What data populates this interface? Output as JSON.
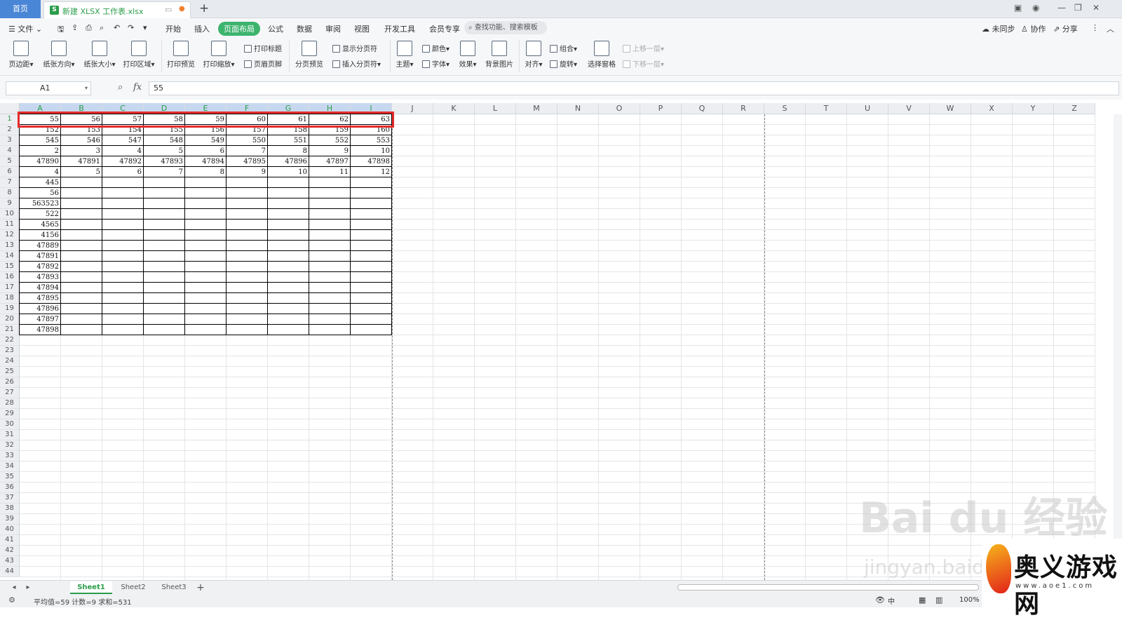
{
  "titlebar": {
    "home_tab": "首页",
    "doc_tab": "新建 XLSX 工作表.xlsx",
    "new_tab": "+"
  },
  "menu": {
    "items": [
      "文件",
      "开始",
      "插入",
      "页面布局",
      "公式",
      "数据",
      "审阅",
      "视图",
      "开发工具",
      "会员专享"
    ],
    "active": "页面布局",
    "search_placeholder": "查找功能、搜索模板",
    "right": [
      "未同步",
      "协作",
      "分享"
    ]
  },
  "ribbon": {
    "large": [
      "页边距",
      "纸张方向",
      "纸张大小",
      "打印区域",
      "打印预览",
      "打印缩放",
      "分页预览",
      "主题",
      "效果",
      "背景图片",
      "对齐",
      "选择窗格"
    ],
    "small": [
      "打印标题",
      "页眉页脚",
      "显示分页符",
      "插入分页符",
      "颜色",
      "字体",
      "组合",
      "旋转",
      "上移一层",
      "下移一层"
    ]
  },
  "formula": {
    "name_box": "A1",
    "fx": "fx",
    "value": "55"
  },
  "columns": [
    "A",
    "B",
    "C",
    "D",
    "E",
    "F",
    "G",
    "H",
    "I",
    "J",
    "K",
    "L",
    "M",
    "N",
    "O",
    "P",
    "Q",
    "R",
    "S",
    "T",
    "U",
    "V",
    "W",
    "X",
    "Y",
    "Z"
  ],
  "rows": [
    "1",
    "2",
    "3",
    "4",
    "5",
    "6",
    "7",
    "8",
    "9",
    "10",
    "11",
    "12",
    "13",
    "14",
    "15",
    "16",
    "17",
    "18",
    "19",
    "20",
    "21",
    "22",
    "23",
    "24",
    "25",
    "26",
    "27",
    "28",
    "29",
    "30",
    "31",
    "32",
    "33",
    "34",
    "35",
    "36",
    "37",
    "38",
    "39",
    "40",
    "41",
    "42",
    "43",
    "44"
  ],
  "cells": [
    [
      "55",
      "56",
      "57",
      "58",
      "59",
      "60",
      "61",
      "62",
      "63"
    ],
    [
      "152",
      "153",
      "154",
      "155",
      "156",
      "157",
      "158",
      "159",
      "160"
    ],
    [
      "545",
      "546",
      "547",
      "548",
      "549",
      "550",
      "551",
      "552",
      "553"
    ],
    [
      "2",
      "3",
      "4",
      "5",
      "6",
      "7",
      "8",
      "9",
      "10"
    ],
    [
      "47890",
      "47891",
      "47892",
      "47893",
      "47894",
      "47895",
      "47896",
      "47897",
      "47898"
    ],
    [
      "4",
      "5",
      "6",
      "7",
      "8",
      "9",
      "10",
      "11",
      "12"
    ],
    [
      "445"
    ],
    [
      "56"
    ],
    [
      "563523"
    ],
    [
      "522"
    ],
    [
      "4565"
    ],
    [
      "4156"
    ],
    [
      "47889"
    ],
    [
      "47891"
    ],
    [
      "47892"
    ],
    [
      "47893"
    ],
    [
      "47894"
    ],
    [
      "47895"
    ],
    [
      "47896"
    ],
    [
      "47897"
    ],
    [
      "47898"
    ]
  ],
  "sheets": {
    "tabs": [
      "Sheet1",
      "Sheet2",
      "Sheet3"
    ],
    "active": "Sheet1",
    "add": "+"
  },
  "status": {
    "text": "平均值=59  计数=9  求和=531",
    "zoom": "100%",
    "lang": "中"
  },
  "watermark": {
    "main": "Bai du 经验",
    "sub": "jingyan.baidu.com"
  },
  "logo": {
    "text": "奥义游戏网",
    "sub": "www.aoe1.com"
  },
  "colors": {
    "accent": "#2a9d4a",
    "highlight": "#e52b2b",
    "home_tab": "#4a86d6"
  }
}
